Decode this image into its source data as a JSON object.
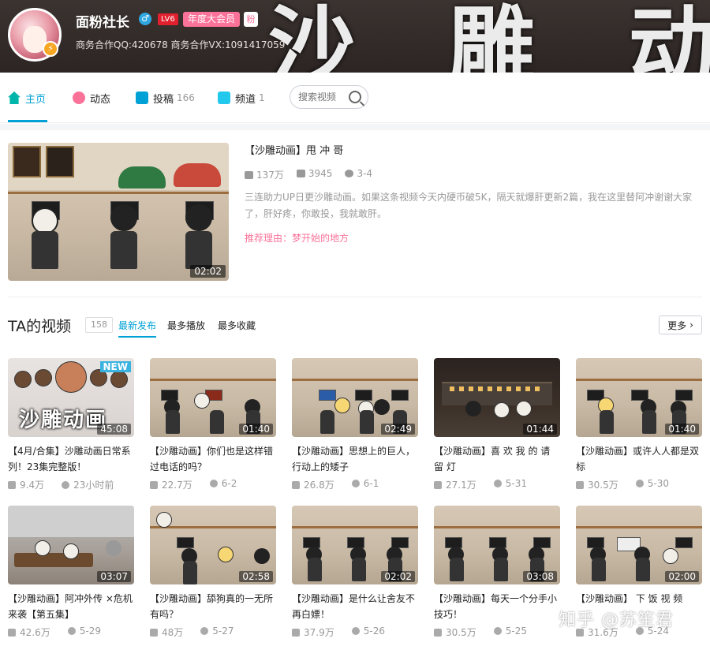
{
  "header": {
    "banner_text": "沙 雕 动 画",
    "username": "面粉社长",
    "gender_symbol": "♂",
    "level": "LV6",
    "vip": "年度大会员",
    "fan_badge": "粉",
    "contact": "商务合作QQ:420678 商务合作VX:1091417059",
    "avatar_badge": "⚡"
  },
  "nav": {
    "tabs": [
      {
        "label": "主页",
        "count": ""
      },
      {
        "label": "动态",
        "count": ""
      },
      {
        "label": "投稿",
        "count": "166"
      },
      {
        "label": "频道",
        "count": "1"
      }
    ],
    "search_placeholder": "搜索视频"
  },
  "featured": {
    "title": "【沙雕动画】甩 冲 哥",
    "views": "137万",
    "danmaku": "3945",
    "date": "3-4",
    "duration": "02:02",
    "description": "三连助力UP日更沙雕动画。如果这条视频今天内硬币破5K，隔天就爆肝更新2篇，我在这里替阿冲谢谢大家了，肝好疼，你敢投，我就敢肝。",
    "reason": "推荐理由：梦开始的地方"
  },
  "videos_header": {
    "title": "TA的视频",
    "count": "158",
    "sort_new": "最新发布",
    "sort_play": "最多播放",
    "sort_fav": "最多收藏",
    "more": "更多"
  },
  "videos": [
    {
      "title": "【4月/合集】沙雕动画日常系列！23集完整版！",
      "views": "9.4万",
      "date": "23小时前",
      "duration": "45:08",
      "badge": "NEW",
      "thumb_text": "沙雕动画"
    },
    {
      "title": "【沙雕动画】你们也是这样错过电话的吗？",
      "views": "22.7万",
      "date": "6-2",
      "duration": "01:40"
    },
    {
      "title": "【沙雕动画】思想上的巨人，行动上的矮子",
      "views": "26.8万",
      "date": "6-1",
      "duration": "02:49"
    },
    {
      "title": "【沙雕动画】喜 欢 我 的 请 留 灯",
      "views": "27.1万",
      "date": "5-31",
      "duration": "01:44"
    },
    {
      "title": "【沙雕动画】或许人人都是双标",
      "views": "30.5万",
      "date": "5-30",
      "duration": "01:40"
    },
    {
      "title": "【沙雕动画】阿冲外传 ×危机来袭【第五集】",
      "views": "42.6万",
      "date": "5-29",
      "duration": "03:07"
    },
    {
      "title": "【沙雕动画】舔狗真的一无所有吗？",
      "views": "48万",
      "date": "5-27",
      "duration": "02:58"
    },
    {
      "title": "【沙雕动画】是什么让舍友不再白嫖！",
      "views": "37.9万",
      "date": "5-26",
      "duration": "02:02"
    },
    {
      "title": "【沙雕动画】每天一个分手小技巧！",
      "views": "30.5万",
      "date": "5-25",
      "duration": "03:08"
    },
    {
      "title": "【沙雕动画】 下 饭 视 频",
      "views": "31.6万",
      "date": "5-24",
      "duration": "02:00"
    }
  ],
  "watermark": "知乎 @苏笙君"
}
